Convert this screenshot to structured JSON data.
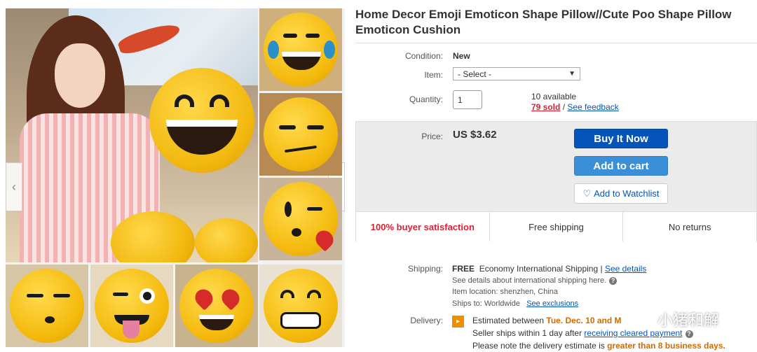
{
  "listing": {
    "title": "Home Decor Emoji Emoticon Shape Pillow//Cute Poo Shape Pillow Emoticon Cushion"
  },
  "details": {
    "condition_label": "Condition:",
    "condition_value": "New",
    "item_label": "Item:",
    "item_select": "- Select -",
    "quantity_label": "Quantity:",
    "quantity_value": "1",
    "available": "10 available",
    "sold": "79 sold",
    "sold_sep": " / ",
    "feedback": "See feedback"
  },
  "buy": {
    "price_label": "Price:",
    "price": "US $3.62",
    "buy_now": "Buy It Now",
    "add_to_cart": "Add to cart",
    "watchlist": "Add to Watchlist"
  },
  "badges": [
    "100% buyer satisfaction",
    "Free shipping",
    "No returns"
  ],
  "shipping": {
    "label": "Shipping:",
    "free": "FREE",
    "method": "Economy International Shipping",
    "details_link": "See details",
    "intl_note": "See details about international shipping here.",
    "location": "Item location:  shenzhen, China",
    "ships_to_label": "Ships to:  Worldwide",
    "exclusions": "See exclusions"
  },
  "delivery": {
    "label": "Delivery:",
    "estimated": "Estimated between ",
    "dates": "Tue. Dec. 10 and M",
    "seller_ships": "Seller ships within 1 day after ",
    "cleared_payment": "receiving cleared payment",
    "note": "Please note the delivery estimate is ",
    "note_emph": "greater than 8 business days."
  },
  "watermark": {
    "text": "小猪和解"
  },
  "colors": {
    "buy_now": "#0654ba",
    "add_to_cart": "#3a8fd6",
    "link": "#0654ba",
    "accent_red": "#dd1e31",
    "delivery_orange": "#f18e00"
  },
  "icons": {
    "prev": "chevron-left-icon",
    "next": "chevron-right-icon",
    "heart": "heart-outline-icon",
    "help": "question-circle-icon",
    "delivery": "delivery-flag-icon"
  }
}
